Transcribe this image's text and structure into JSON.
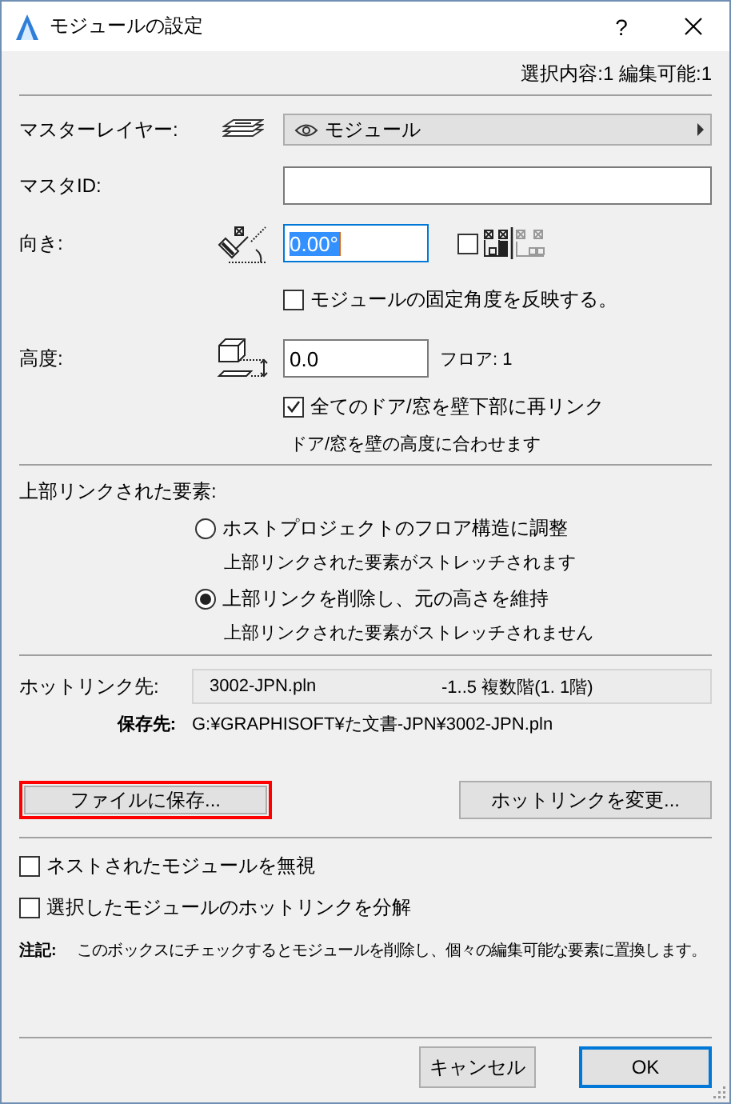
{
  "window": {
    "title": "モジュールの設定",
    "help_button": "?"
  },
  "selection_info": "選択内容:1 編集可能:1",
  "master_layer": {
    "label": "マスターレイヤー:",
    "value": "モジュール"
  },
  "master_id": {
    "label": "マスタID:"
  },
  "orientation": {
    "label": "向き:",
    "value": "0.00°",
    "mirror_checked": false
  },
  "fixed_angle": {
    "label": "モジュールの固定角度を反映する。",
    "checked": false
  },
  "elevation": {
    "label": "高度:",
    "value": "0.0",
    "floor": "フロア: 1"
  },
  "relink": {
    "label": "全てのドア/窓を壁下部に再リンク",
    "checked": true,
    "hint": "ドア/窓を壁の高度に合わせます"
  },
  "top_linked": {
    "label": "上部リンクされた要素:",
    "options": [
      {
        "label": "ホストプロジェクトのフロア構造に調整",
        "hint": "上部リンクされた要素がストレッチされます",
        "selected": false
      },
      {
        "label": "上部リンクを削除し、元の高さを維持",
        "hint": "上部リンクされた要素がストレッチされません",
        "selected": true
      }
    ]
  },
  "hotlink": {
    "label": "ホットリンク先:",
    "file": "3002-JPN.pln",
    "stories": "-1..5 複数階(1. 1階)",
    "save_label": "保存先:",
    "save_path": "G:¥GRAPHISOFT¥た文書-JPN¥3002-JPN.pln"
  },
  "file_buttons": [
    {
      "label": "ファイルに保存...",
      "highlighted": true
    },
    {
      "label": "ホットリンクを変更...",
      "highlighted": false
    }
  ],
  "options": [
    {
      "label": "ネストされたモジュールを無視",
      "checked": false
    },
    {
      "label": "選択したモジュールのホットリンクを分解",
      "checked": false
    }
  ],
  "note": {
    "label": "注記:",
    "text": "このボックスにチェックするとモジュールを削除し、個々の編集可能な要素に置換します。"
  },
  "buttons": [
    {
      "label": "キャンセル",
      "default": false
    },
    {
      "label": "OK",
      "default": true
    }
  ]
}
